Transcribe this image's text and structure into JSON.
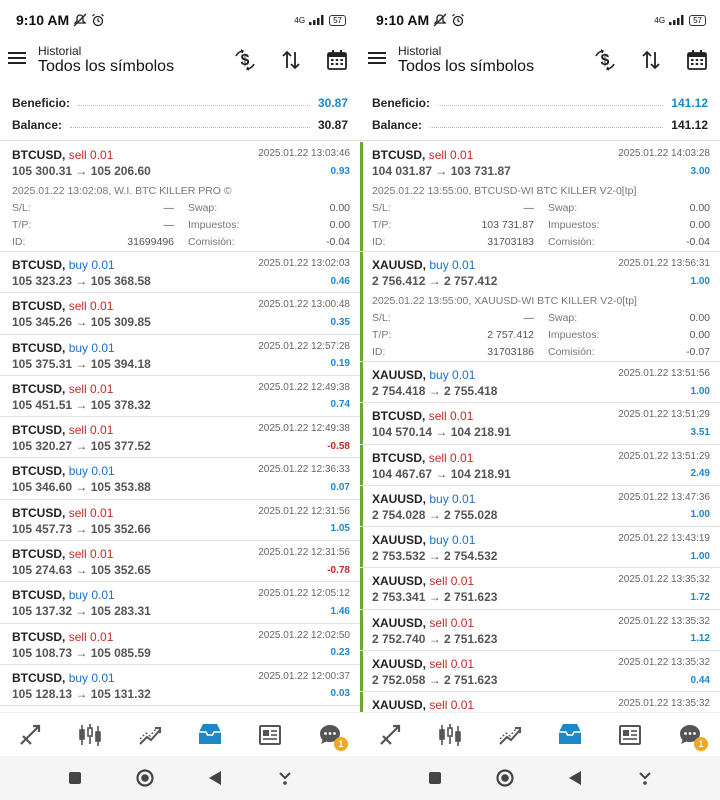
{
  "screens": [
    {
      "status": {
        "time": "9:10 AM",
        "network": "4G",
        "battery": "57"
      },
      "header": {
        "small": "Historial",
        "big": "Todos los símbolos"
      },
      "summary": {
        "profit_label": "Beneficio:",
        "profit": "30.87",
        "balance_label": "Balance:",
        "balance": "30.87"
      },
      "deals": [
        {
          "symbol": "BTCUSD,",
          "type": "sell 0.01",
          "dir": "sell",
          "datetime": "2025.01.22 13:03:46",
          "prices": "105 300.31 → 105 206.60",
          "profit": "0.93",
          "sign": "pos",
          "expanded": true,
          "comment": "2025.01.22 13:02:08, W.I. BTC KILLER PRO ©",
          "sl_label": "S/L:",
          "sl": "—",
          "swap_label": "Swap:",
          "swap": "0.00",
          "tp_label": "T/P:",
          "tp": "—",
          "tax_label": "Impuestos:",
          "tax": "0.00",
          "id_label": "ID:",
          "id": "31699496",
          "comm_label": "Comisión:",
          "comm": "-0.04"
        },
        {
          "symbol": "BTCUSD,",
          "type": "buy 0.01",
          "dir": "buy",
          "datetime": "2025.01.22 13:02:03",
          "prices": "105 323.23 → 105 368.58",
          "profit": "0.46",
          "sign": "pos"
        },
        {
          "symbol": "BTCUSD,",
          "type": "sell 0.01",
          "dir": "sell",
          "datetime": "2025.01.22 13:00:48",
          "prices": "105 345.26 → 105 309.85",
          "profit": "0.35",
          "sign": "pos"
        },
        {
          "symbol": "BTCUSD,",
          "type": "buy 0.01",
          "dir": "buy",
          "datetime": "2025.01.22 12:57:28",
          "prices": "105 375.31 → 105 394.18",
          "profit": "0.19",
          "sign": "pos"
        },
        {
          "symbol": "BTCUSD,",
          "type": "sell 0.01",
          "dir": "sell",
          "datetime": "2025.01.22 12:49:38",
          "prices": "105 451.51 → 105 378.32",
          "profit": "0.74",
          "sign": "pos"
        },
        {
          "symbol": "BTCUSD,",
          "type": "sell 0.01",
          "dir": "sell",
          "datetime": "2025.01.22 12:49:38",
          "prices": "105 320.27 → 105 377.52",
          "profit": "-0.58",
          "sign": "neg"
        },
        {
          "symbol": "BTCUSD,",
          "type": "buy 0.01",
          "dir": "buy",
          "datetime": "2025.01.22 12:36:33",
          "prices": "105 346.60 → 105 353.88",
          "profit": "0.07",
          "sign": "pos"
        },
        {
          "symbol": "BTCUSD,",
          "type": "sell 0.01",
          "dir": "sell",
          "datetime": "2025.01.22 12:31:56",
          "prices": "105 457.73 → 105 352.66",
          "profit": "1.05",
          "sign": "pos"
        },
        {
          "symbol": "BTCUSD,",
          "type": "sell 0.01",
          "dir": "sell",
          "datetime": "2025.01.22 12:31:56",
          "prices": "105 274.63 → 105 352.65",
          "profit": "-0.78",
          "sign": "neg"
        },
        {
          "symbol": "BTCUSD,",
          "type": "buy 0.01",
          "dir": "buy",
          "datetime": "2025.01.22 12:05:12",
          "prices": "105 137.32 → 105 283.31",
          "profit": "1.46",
          "sign": "pos"
        },
        {
          "symbol": "BTCUSD,",
          "type": "sell 0.01",
          "dir": "sell",
          "datetime": "2025.01.22 12:02:50",
          "prices": "105 108.73 → 105 085.59",
          "profit": "0.23",
          "sign": "pos"
        },
        {
          "symbol": "BTCUSD,",
          "type": "buy 0.01",
          "dir": "buy",
          "datetime": "2025.01.22 12:00:37",
          "prices": "105 128.13 → 105 131.32",
          "profit": "0.03",
          "sign": "pos"
        }
      ],
      "badge": "1"
    },
    {
      "status": {
        "time": "9:10 AM",
        "network": "4G",
        "battery": "57"
      },
      "header": {
        "small": "Historial",
        "big": "Todos los símbolos"
      },
      "summary": {
        "profit_label": "Beneficio:",
        "profit": "141.12",
        "balance_label": "Balance:",
        "balance": "141.12"
      },
      "deals": [
        {
          "symbol": "BTCUSD,",
          "type": "sell 0.01",
          "dir": "sell",
          "datetime": "2025.01.22 14:03:28",
          "prices": "104 031.87 → 103 731.87",
          "profit": "3.00",
          "sign": "pos",
          "expanded": true,
          "mark": true,
          "comment": "2025.01.22 13:55:00, BTCUSD-WI BTC KILLER V2-0[tp]",
          "sl_label": "S/L:",
          "sl": "—",
          "swap_label": "Swap:",
          "swap": "0.00",
          "tp_label": "T/P:",
          "tp": "103 731.87",
          "tax_label": "Impuestos:",
          "tax": "0.00",
          "id_label": "ID:",
          "id": "31703183",
          "comm_label": "Comisión:",
          "comm": "-0.04"
        },
        {
          "symbol": "XAUUSD,",
          "type": "buy 0.01",
          "dir": "buy",
          "datetime": "2025.01.22 13:56:31",
          "prices": "2 756.412 → 2 757.412",
          "profit": "1.00",
          "sign": "pos",
          "expanded": true,
          "mark": true,
          "comment": "2025.01.22 13:55:00, XAUUSD-WI BTC KILLER V2-0[tp]",
          "sl_label": "S/L:",
          "sl": "—",
          "swap_label": "Swap:",
          "swap": "0.00",
          "tp_label": "T/P:",
          "tp": "2 757.412",
          "tax_label": "Impuestos:",
          "tax": "0.00",
          "id_label": "ID:",
          "id": "31703186",
          "comm_label": "Comisión:",
          "comm": "-0.07"
        },
        {
          "symbol": "XAUUSD,",
          "type": "buy 0.01",
          "dir": "buy",
          "datetime": "2025.01.22 13:51:56",
          "prices": "2 754.418 → 2 755.418",
          "profit": "1.00",
          "sign": "pos",
          "mark": true
        },
        {
          "symbol": "BTCUSD,",
          "type": "sell 0.01",
          "dir": "sell",
          "datetime": "2025.01.22 13:51:29",
          "prices": "104 570.14 → 104 218.91",
          "profit": "3.51",
          "sign": "pos",
          "mark": true
        },
        {
          "symbol": "BTCUSD,",
          "type": "sell 0.01",
          "dir": "sell",
          "datetime": "2025.01.22 13:51:29",
          "prices": "104 467.67 → 104 218.91",
          "profit": "2.49",
          "sign": "pos",
          "mark": true
        },
        {
          "symbol": "XAUUSD,",
          "type": "buy 0.01",
          "dir": "buy",
          "datetime": "2025.01.22 13:47:36",
          "prices": "2 754.028 → 2 755.028",
          "profit": "1.00",
          "sign": "pos",
          "mark": true
        },
        {
          "symbol": "XAUUSD,",
          "type": "buy 0.01",
          "dir": "buy",
          "datetime": "2025.01.22 13:43:19",
          "prices": "2 753.532 → 2 754.532",
          "profit": "1.00",
          "sign": "pos",
          "mark": true
        },
        {
          "symbol": "XAUUSD,",
          "type": "sell 0.01",
          "dir": "sell",
          "datetime": "2025.01.22 13:35:32",
          "prices": "2 753.341 → 2 751.623",
          "profit": "1.72",
          "sign": "pos",
          "mark": true
        },
        {
          "symbol": "XAUUSD,",
          "type": "sell 0.01",
          "dir": "sell",
          "datetime": "2025.01.22 13:35:32",
          "prices": "2 752.740 → 2 751.623",
          "profit": "1.12",
          "sign": "pos",
          "mark": true
        },
        {
          "symbol": "XAUUSD,",
          "type": "sell 0.01",
          "dir": "sell",
          "datetime": "2025.01.22 13:35:32",
          "prices": "2 752.058 → 2 751.623",
          "profit": "0.44",
          "sign": "pos",
          "mark": true
        },
        {
          "symbol": "XAUUSD,",
          "type": "sell 0.01",
          "dir": "sell",
          "datetime": "2025.01.22 13:35:32",
          "prices": "",
          "profit": "",
          "sign": "pos",
          "mark": true
        }
      ],
      "badge": "1"
    }
  ],
  "colors": {
    "sell": "#c62828",
    "buy": "#1e6fc7",
    "profit": "#1e88c7",
    "loss": "#c62828",
    "accent": "#1e88c7",
    "mark": "#6aa637",
    "badge": "#f5a623"
  },
  "icons": {
    "status": [
      "silent-icon",
      "alarm-icon",
      "signal-icon",
      "battery-icon"
    ],
    "header": [
      "menu-icon",
      "currency-icon",
      "sort-icon",
      "calendar-icon"
    ],
    "nav": [
      "quotes-icon",
      "chart-icon",
      "trade-icon",
      "history-icon",
      "news-icon",
      "messages-icon"
    ],
    "system": [
      "recents-icon",
      "home-icon",
      "back-icon",
      "keyboard-down-icon"
    ]
  }
}
